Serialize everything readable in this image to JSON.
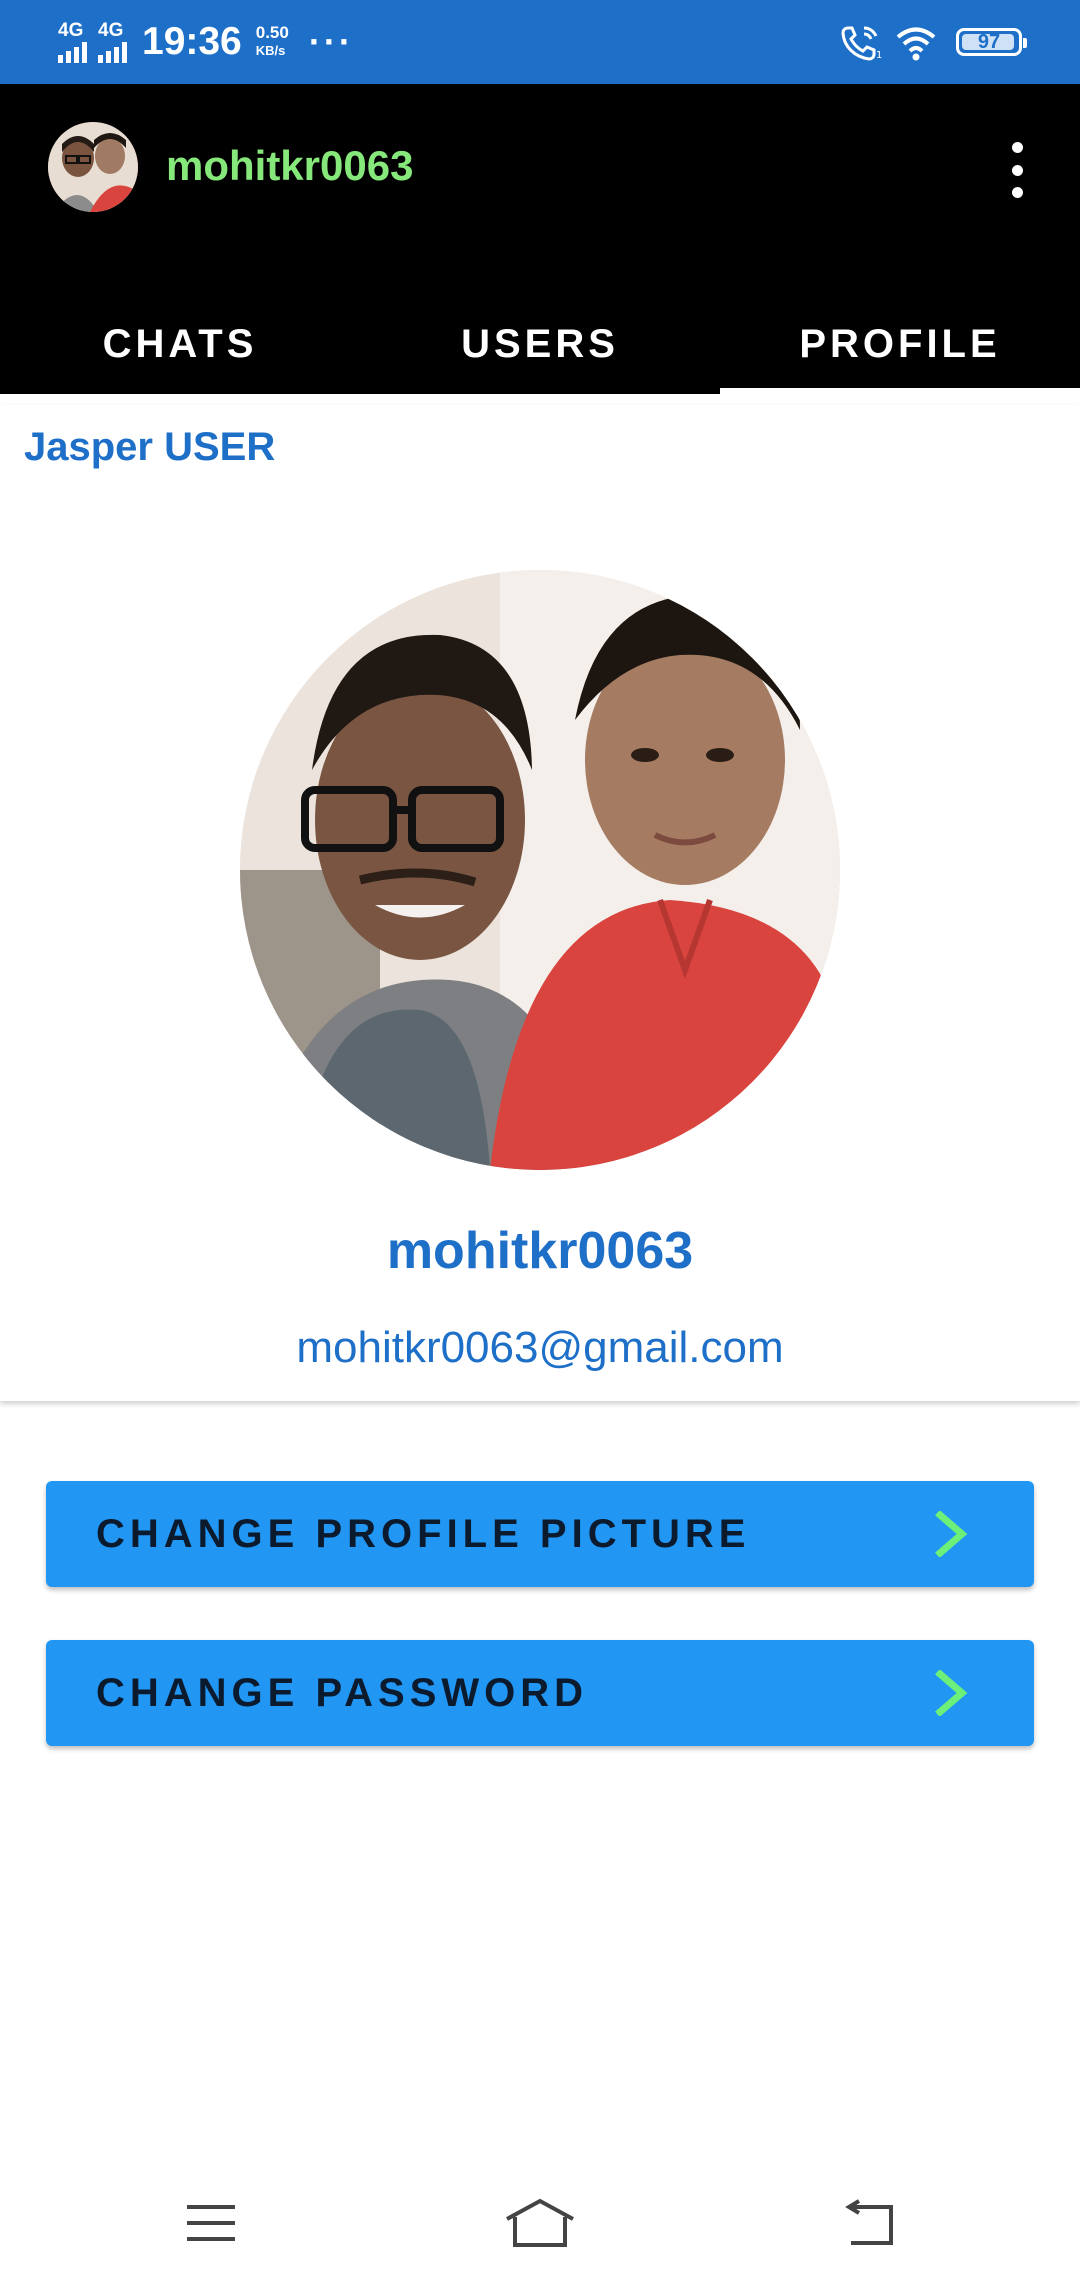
{
  "colors": {
    "status_bar": "#1e6fc8",
    "app_bar": "#000000",
    "username_green": "#86e87a",
    "accent_blue": "#1e6fc8",
    "button_blue": "#2196f3",
    "chevron_green": "#6cf07a"
  },
  "status_bar": {
    "network_1": "4G",
    "network_2": "4G",
    "time": "19:36",
    "speed_value": "0.50",
    "speed_unit": "KB/s",
    "more": "···",
    "battery": "97",
    "battery_level": 0.97,
    "icons": [
      "signal-icon",
      "signal-icon",
      "wifi-calling-icon",
      "wifi-icon",
      "battery-icon"
    ]
  },
  "app_bar": {
    "username": "mohitkr0063",
    "menu_icon": "more-vert-icon"
  },
  "tabs": [
    {
      "label": "CHATS",
      "active": false
    },
    {
      "label": "USERS",
      "active": false
    },
    {
      "label": "PROFILE",
      "active": true
    }
  ],
  "profile": {
    "card_title": "Jasper USER",
    "name": "mohitkr0063",
    "email": "mohitkr0063@gmail.com"
  },
  "actions": {
    "change_picture": "CHANGE PROFILE PICTURE",
    "change_password": "CHANGE PASSWORD",
    "icon": "chevron-right-icon"
  },
  "nav_bar": {
    "icons": [
      "menu-icon",
      "home-icon",
      "back-icon"
    ]
  }
}
